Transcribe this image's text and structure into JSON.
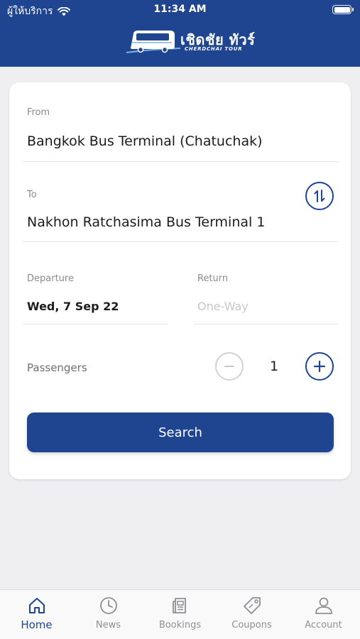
{
  "status_bar": {
    "carrier": "ผู้ให้บริการ",
    "time": "11:34 AM"
  },
  "brand": {
    "name_thai": "เชิดชัย ทัวร์",
    "name_en": "CHERDCHAI TOUR"
  },
  "colors": {
    "primary": "#1f4591",
    "background": "#efeff1",
    "card": "#ffffff",
    "muted": "#8e8e93"
  },
  "form": {
    "from": {
      "label": "From",
      "value": "Bangkok Bus Terminal (Chatuchak)"
    },
    "to": {
      "label": "To",
      "value": "Nakhon Ratchasima Bus Terminal 1"
    },
    "swap_icon": "swap-vertical-icon",
    "departure": {
      "label": "Departure",
      "value": "Wed, 7 Sep 22"
    },
    "return": {
      "label": "Return",
      "placeholder": "One-Way"
    },
    "passengers": {
      "label": "Passengers",
      "count": "1",
      "minus_icon": "minus-icon",
      "plus_icon": "plus-icon"
    },
    "search_label": "Search"
  },
  "tabs": [
    {
      "label": "Home",
      "icon": "home-icon",
      "active": true
    },
    {
      "label": "News",
      "icon": "clock-icon",
      "active": false
    },
    {
      "label": "Bookings",
      "icon": "bookings-icon",
      "active": false
    },
    {
      "label": "Coupons",
      "icon": "coupon-tag-icon",
      "active": false
    },
    {
      "label": "Account",
      "icon": "user-icon",
      "active": false
    }
  ]
}
